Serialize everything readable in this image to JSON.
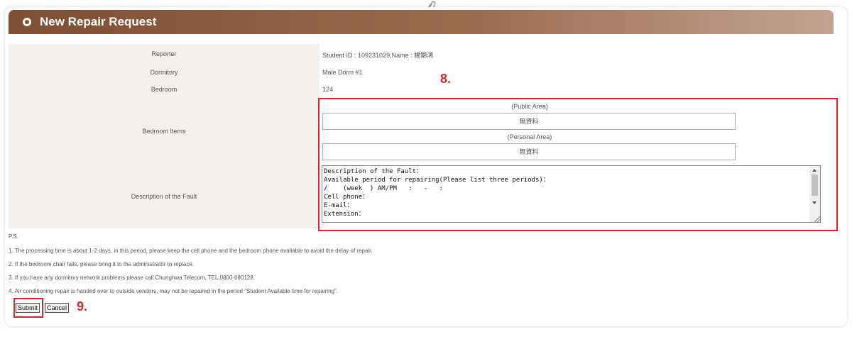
{
  "header": {
    "title": "New Repair Request"
  },
  "form": {
    "reporter_label": "Reporter",
    "reporter_value": "Student ID : 109231029,Name : 楊錦鴻",
    "dormitory_label": "Dormitory",
    "dormitory_value": "Male Dorm #1",
    "bedroom_label": "Bedroom",
    "bedroom_value": "124",
    "bedroom_items_label": "Bedroom Items",
    "public_area_label": "(Public Area)",
    "public_area_value": "無資料",
    "personal_area_label": "(Personal Area)",
    "personal_area_value": "無資料",
    "fault_label": "Description of the Fault",
    "fault_text": "Description of the Fault：\nAvailable period for repairing(Please list three periods)：\n/    (week  ) AM/PM   :   -   :\nCell phone：\nE-mail：\nExtension："
  },
  "annotations": {
    "mark8": "8.",
    "mark9": "9."
  },
  "notes": {
    "ps": "P.S.",
    "items": [
      "1. The processing time is about 1-2 days, in this period, please keep the cell phone and the bedroom phone avaliable to avoid the delay of repair.",
      "2. If the bedroom chair fails, please bring it to the administrator to replace.",
      "3. If you have any dormitory network problems please call Chunghwa Telecom, TEL:0800-080128.",
      "4. Air conditioning repair is handed over to outside vendors, may not be repaired in the period \"Student Available time for repairing\"."
    ]
  },
  "buttons": {
    "submit": "Submit",
    "cancel": "Cancel"
  },
  "colors": {
    "header_start": "#7f4e32",
    "header_end": "#c4a390",
    "annotation_red": "#d9262c",
    "label_bg": "#f4f1ec"
  },
  "icons": {
    "header": "radio-circle-icon",
    "top": "paperclip-icon"
  }
}
